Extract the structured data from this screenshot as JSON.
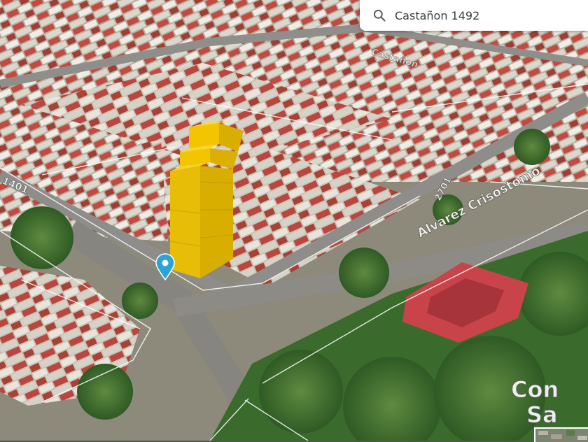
{
  "search": {
    "value": "Castañon 1492",
    "icon": "search-icon"
  },
  "map": {
    "type": "satellite-3d",
    "streets": {
      "street_a": "1401",
      "street_b": "Castañon",
      "street_c": "Alvarez Crisostomo",
      "house_number": "2701"
    },
    "place_label_line1": "Con",
    "place_label_line2": "Sa",
    "colors": {
      "building_highlight": "#f2c500",
      "pin": "#2aa3d8",
      "road": "#8c8c8a",
      "vegetation": "#3f6a2e"
    }
  },
  "minimap": {
    "label": "minimap-thumbnail"
  }
}
